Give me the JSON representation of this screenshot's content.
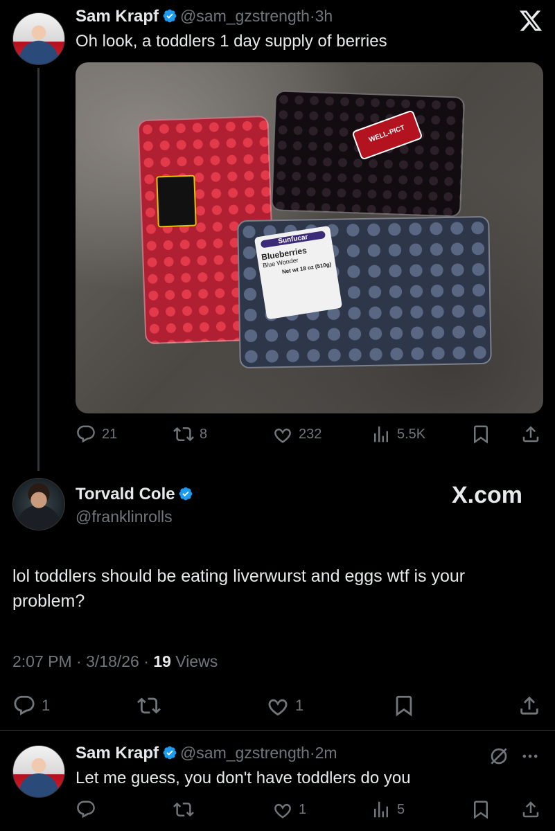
{
  "tweet1": {
    "name": "Sam Krapf",
    "handle": "@sam_gzstrength",
    "time": "3h",
    "text": "Oh look, a toddlers 1 day supply of berries",
    "media_stickers": {
      "wellpict": "WELL-PICT",
      "sunfucar": "Sunfucar",
      "blueberries": "Blueberries",
      "blue_wonder": "Blue Wonder",
      "net_wt": "Net wt 18 oz (510g)"
    },
    "stats": {
      "replies": "21",
      "reposts": "8",
      "likes": "232",
      "views": "5.5K"
    }
  },
  "tweet2": {
    "name": "Torvald Cole",
    "handle": "@franklinrolls",
    "text": "lol toddlers should be eating liverwurst and eggs wtf is your problem?",
    "time": "2:07 PM",
    "date": "3/18/26",
    "views_count": "19",
    "views_label": "Views",
    "stats": {
      "replies": "1",
      "likes": "1"
    }
  },
  "tweet3": {
    "name": "Sam Krapf",
    "handle": "@sam_gzstrength",
    "time": "2m",
    "text": "Let me guess, you don't have toddlers do you",
    "stats": {
      "likes": "1",
      "views": "5"
    }
  },
  "brand": {
    "x_logo": "X",
    "x_com": "X.com"
  },
  "icons": {
    "verified": "verified-badge-icon",
    "reply": "reply-icon",
    "repost": "repost-icon",
    "like": "heart-icon",
    "views": "views-icon",
    "bookmark": "bookmark-icon",
    "share": "share-icon",
    "more": "more-icon",
    "grok": "grok-icon"
  },
  "colors": {
    "background": "#000000",
    "primary_text": "#e7e9ea",
    "secondary_text": "#71767b",
    "verified": "#1d9bf0",
    "divider": "#2f3336"
  }
}
